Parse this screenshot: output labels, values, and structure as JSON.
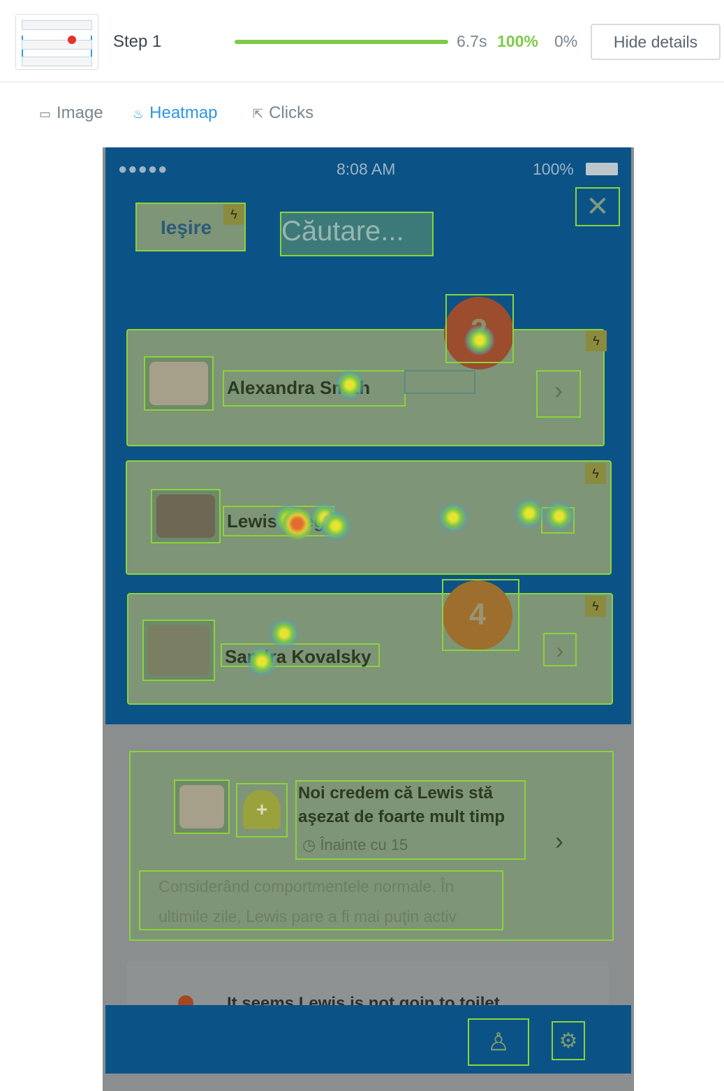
{
  "header": {
    "step_label": "Step 1",
    "time": "6.7s",
    "success_pct": "100%",
    "fail_pct": "0%",
    "progress": 1.0,
    "hide_button": "Hide details"
  },
  "tabs": [
    {
      "label": "Image",
      "icon": "image-icon"
    },
    {
      "label": "Heatmap",
      "icon": "flame-icon"
    },
    {
      "label": "Clicks",
      "icon": "cursor-icon"
    }
  ],
  "phone": {
    "status": {
      "signal": "●●●●●",
      "time": "8:08 AM",
      "battery": "100%"
    },
    "exit_label": "Ieşire",
    "search_placeholder": "Căutare...",
    "contacts": [
      {
        "name": "Alexandra Smith"
      },
      {
        "name": "Lewis Greg"
      },
      {
        "name": "Sandra Kovalsky"
      }
    ],
    "click_counts": {
      "first": "2",
      "second": "4"
    },
    "notification": {
      "title": "Noi credem că Lewis stă aşezat de foarte mult timp",
      "time": "Înainte cu 15",
      "body": "Considerând comportmentele normale. În ultimile zile, Lewis pare a fi mai puţin activ"
    },
    "second_notification": "It seems Lewis is not goin to toilet"
  },
  "colors": {
    "accent": "#2e96e0",
    "success": "#7fc947",
    "phone_blue": "#0b5387",
    "highlight": "#8ad43a"
  }
}
